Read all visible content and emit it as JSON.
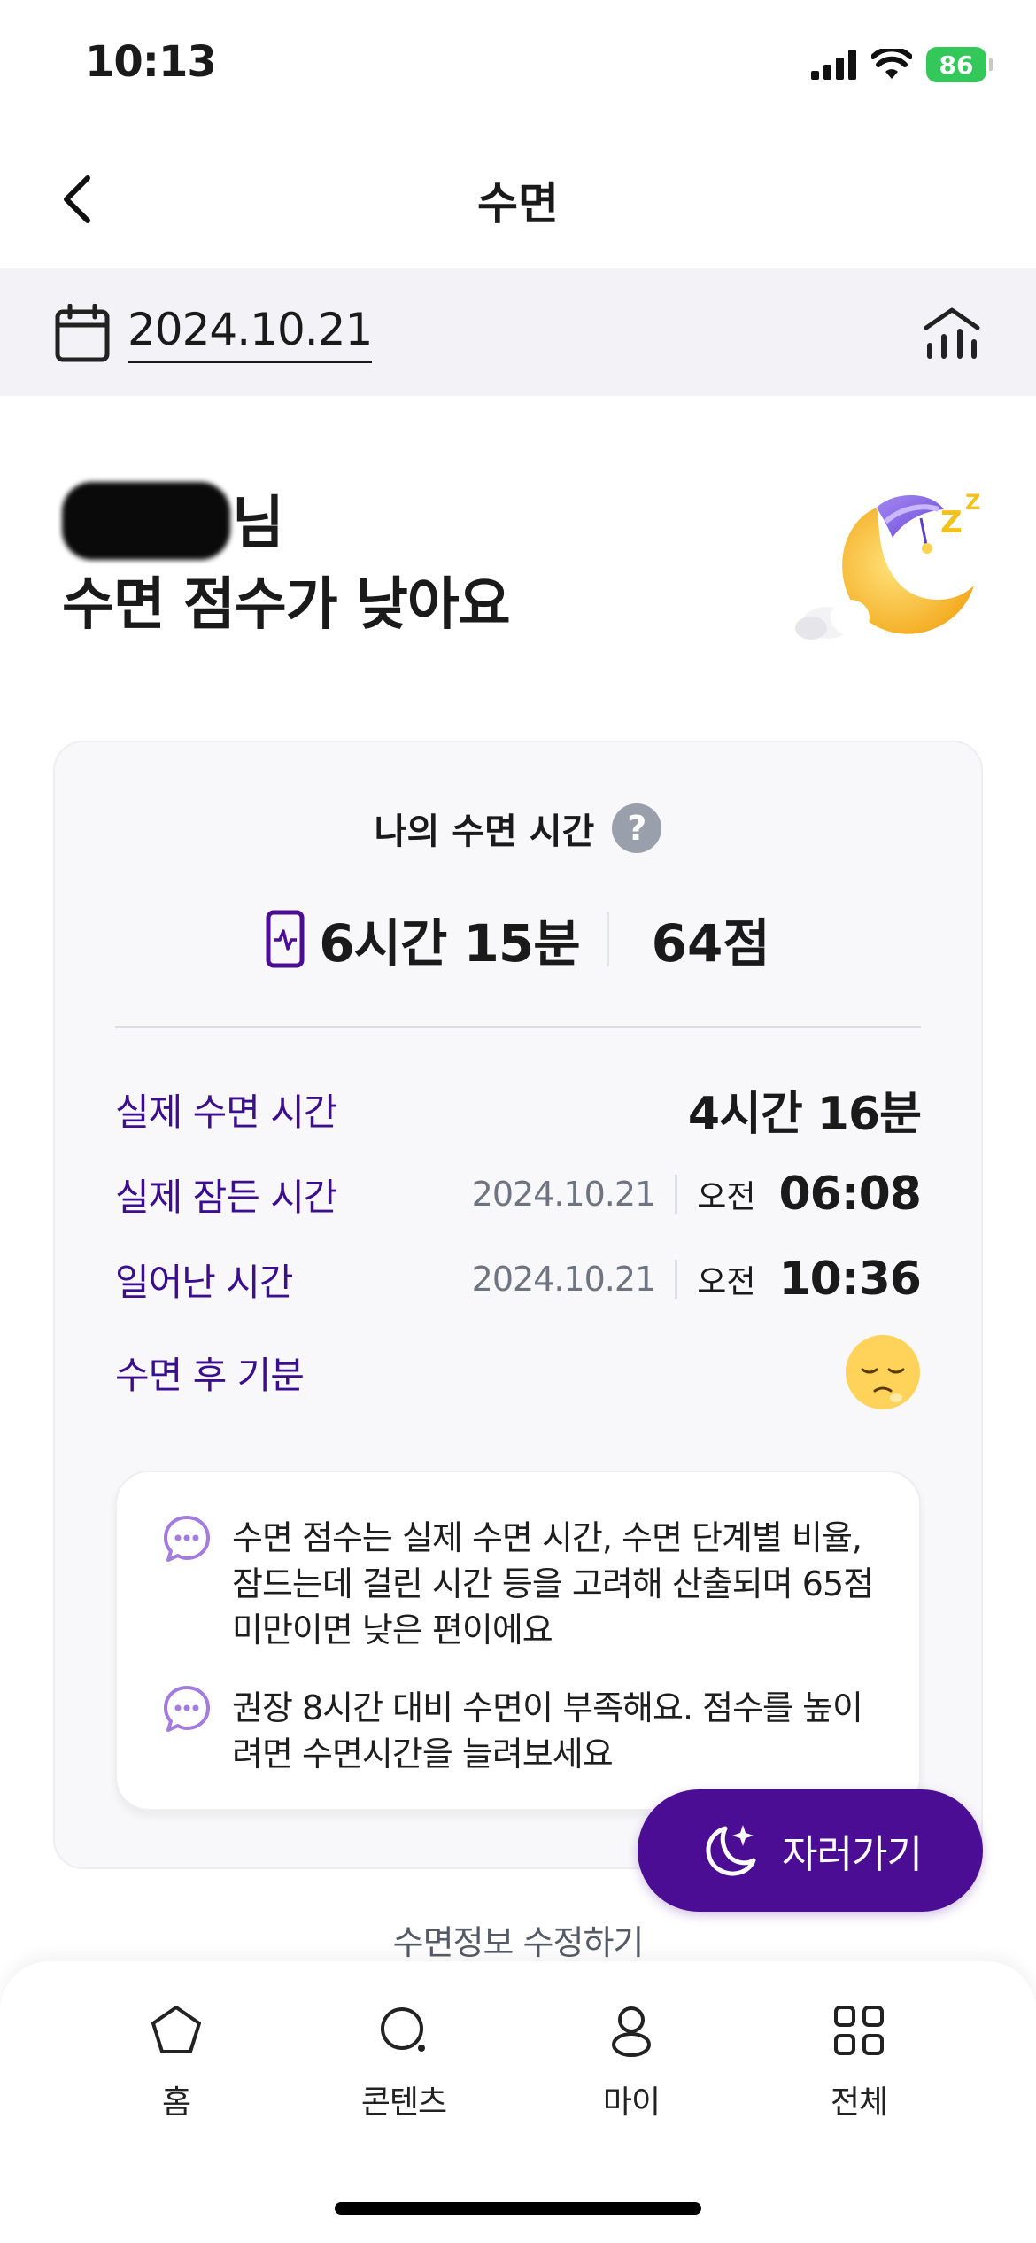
{
  "status_bar": {
    "time": "10:13",
    "battery": "86"
  },
  "header": {
    "title": "수면"
  },
  "date_bar": {
    "date": "2024.10.21"
  },
  "greeting": {
    "name_suffix": "님",
    "message": "수면 점수가 낮아요"
  },
  "card": {
    "title": "나의 수면 시간",
    "help_symbol": "?",
    "total_time": "6시간 15분",
    "score": "64점",
    "rows": {
      "actual_sleep": {
        "label": "실제 수면 시간",
        "value": "4시간 16분"
      },
      "fell_asleep": {
        "label": "실제 잠든 시간",
        "date": "2024.10.21",
        "ampm": "오전",
        "time": "06:08"
      },
      "woke_up": {
        "label": "일어난 시간",
        "date": "2024.10.21",
        "ampm": "오전",
        "time": "10:36"
      },
      "mood": {
        "label": "수면 후 기분"
      }
    },
    "notes": [
      "수면 점수는 실제 수면 시간, 수면 단계별 비율, 잠드는데 걸린 시간 등을 고려해 산출되며 65점 미만이면 낮은 편이에요",
      "권장 8시간 대비 수면이 부족해요. 점수를 높이려면 수면시간을 늘려보세요"
    ]
  },
  "sleep_button": {
    "label": "자러가기"
  },
  "edit_link": "수면정보 수정하기",
  "tab_bar": {
    "tabs": [
      {
        "label": "홈",
        "icon": "home-icon"
      },
      {
        "label": "콘텐츠",
        "icon": "contents-icon"
      },
      {
        "label": "마이",
        "icon": "profile-icon"
      },
      {
        "label": "전체",
        "icon": "grid-icon"
      }
    ]
  },
  "colors": {
    "accent": "#4a0d93",
    "label_purple": "#3a0e8c",
    "date_bar_bg": "#f2f2f7"
  }
}
